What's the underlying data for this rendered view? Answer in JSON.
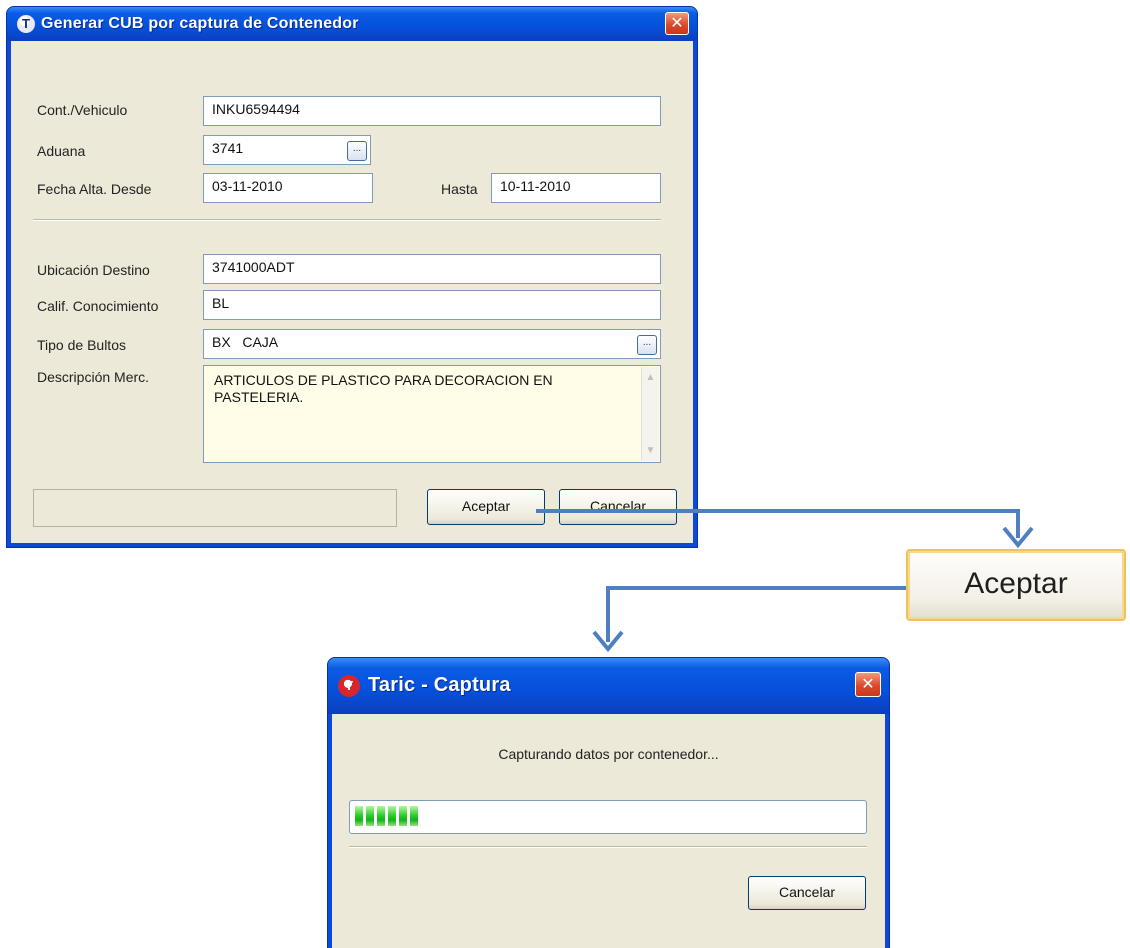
{
  "dialog_main": {
    "title": "Generar CUB por captura de Contenedor",
    "close_glyph": "✕",
    "icon_glyph": "T",
    "fields": {
      "cont_label": "Cont./Vehiculo",
      "cont_value": "INKU6594494",
      "aduana_label": "Aduana",
      "aduana_value": "3741",
      "fecha_label": "Fecha Alta.  Desde",
      "fecha_desde": "03-11-2010",
      "hasta_label": "Hasta",
      "fecha_hasta": "10-11-2010",
      "ubicacion_label": "Ubicación Destino",
      "ubicacion_value": "3741000ADT",
      "calif_label": "Calif. Conocimiento",
      "calif_value": "BL",
      "tipo_label": "Tipo de Bultos",
      "tipo_value": "BX   CAJA",
      "desc_label": "Descripción Merc.",
      "desc_value": "ARTICULOS DE PLASTICO PARA DECORACION EN PASTELERIA."
    },
    "dots_glyph": "...",
    "buttons": {
      "accept": "Aceptar",
      "cancel": "Cancelar"
    }
  },
  "zoom_button": {
    "label": "Aceptar"
  },
  "dialog_capture": {
    "title": "Taric  -  Captura",
    "icon_glyph": "T",
    "close_glyph": "✕",
    "message": "Capturando datos por contenedor...",
    "progress_percent": 13,
    "cancel": "Cancelar"
  },
  "colors": {
    "titlebar": "#0551dc",
    "window_body": "#ece9d8",
    "arrow": "#4f7fc0",
    "progress": "#2fcf2f",
    "zoom_border": "#f1c15a"
  }
}
